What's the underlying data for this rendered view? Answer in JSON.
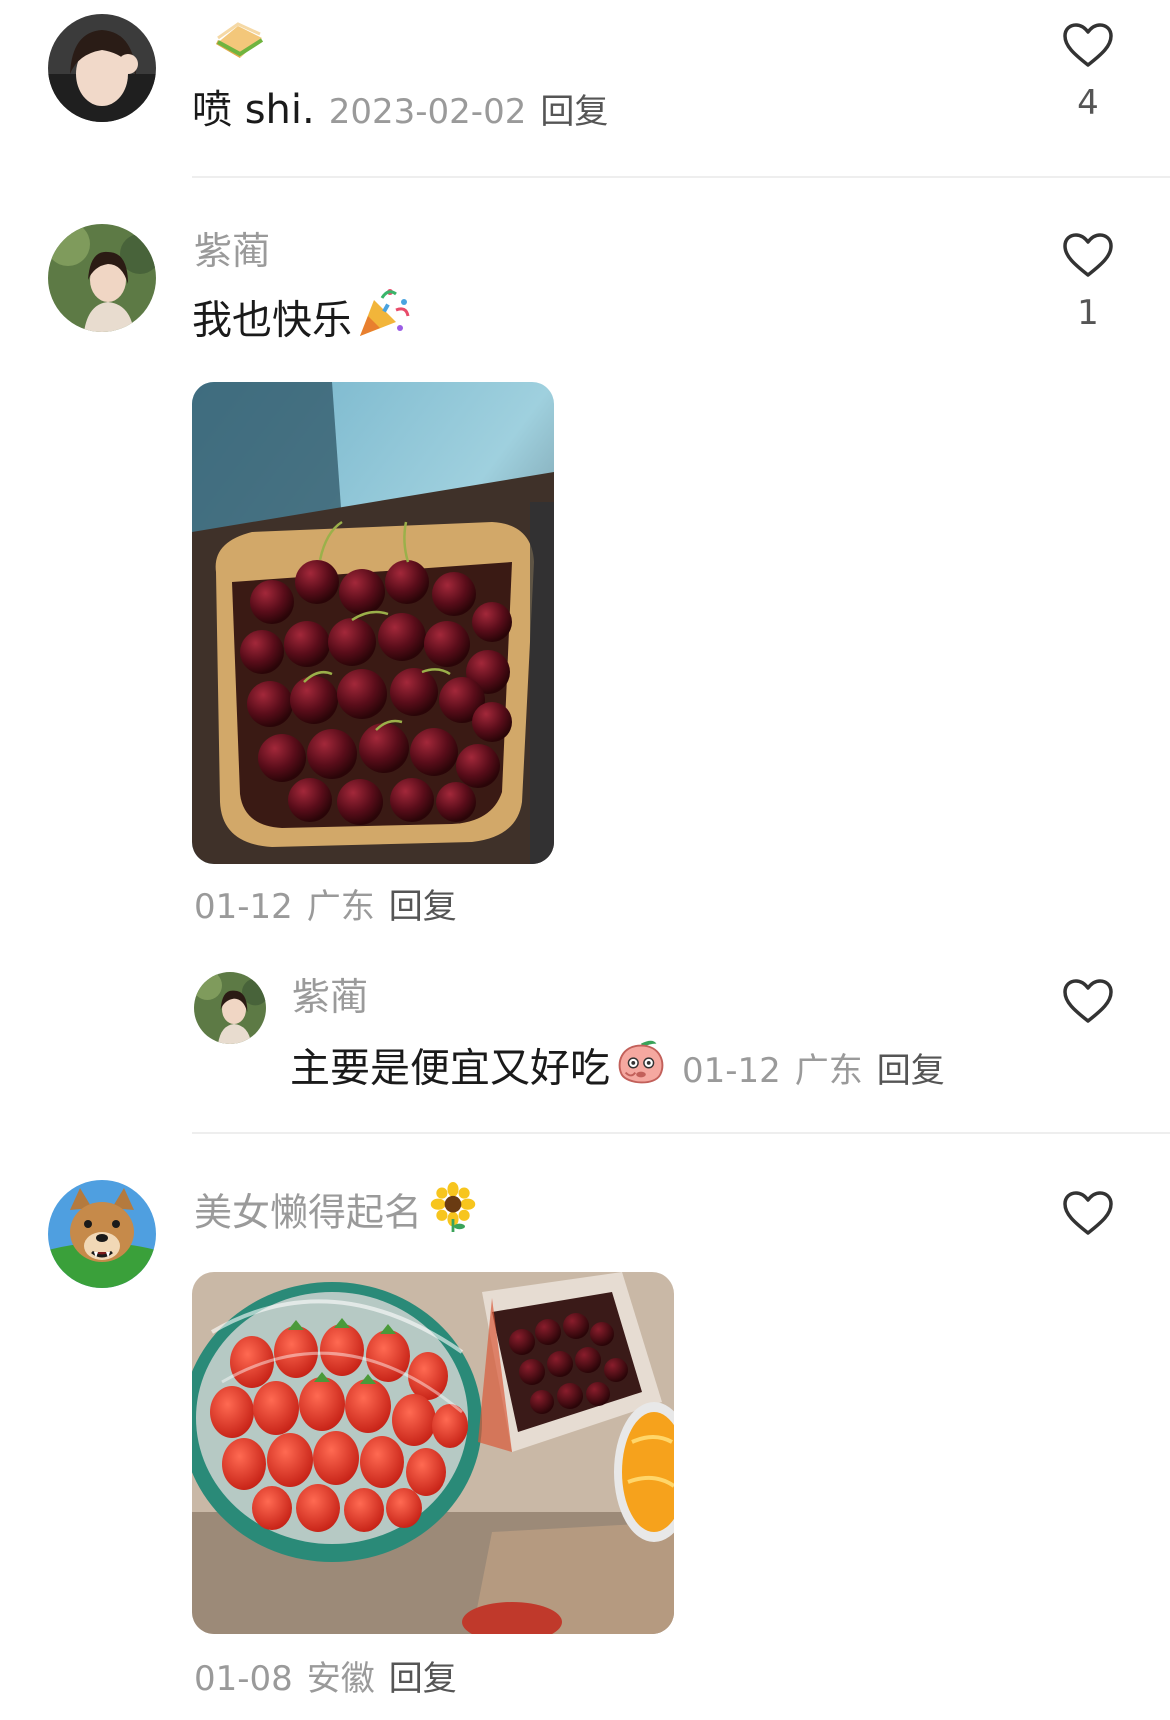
{
  "comments": [
    {
      "avatar_icon": "user-avatar-icon",
      "emoji_icon": "sandwich-icon",
      "text": "喷 shi.",
      "date": "2023-02-02",
      "reply_label": "回复",
      "like_count": "4"
    },
    {
      "username": "紫蔺",
      "avatar_icon": "user-avatar-icon",
      "text": "我也快乐",
      "text_emoji_icon": "party-popper-icon",
      "image_alt_icon": "cherries-photo-icon",
      "date": "01-12",
      "location": "广东",
      "reply_label": "回复",
      "like_count": "1",
      "replies": [
        {
          "username": "紫蔺",
          "avatar_icon": "user-avatar-icon",
          "text": "主要是便宜又好吃",
          "text_emoji_icon": "peach-emoji-icon",
          "date": "01-12",
          "location": "广东",
          "reply_label": "回复"
        }
      ]
    },
    {
      "username": "美女懒得起名",
      "username_emoji_icon": "sunflower-icon",
      "avatar_icon": "dog-avatar-icon",
      "image_alt_icon": "fruit-photo-icon",
      "date": "01-08",
      "location": "安徽",
      "reply_label": "回复"
    }
  ],
  "colors": {
    "muted_text": "#9a9a9a",
    "body_text": "#1a1a1a",
    "divider": "#eeeeee"
  }
}
